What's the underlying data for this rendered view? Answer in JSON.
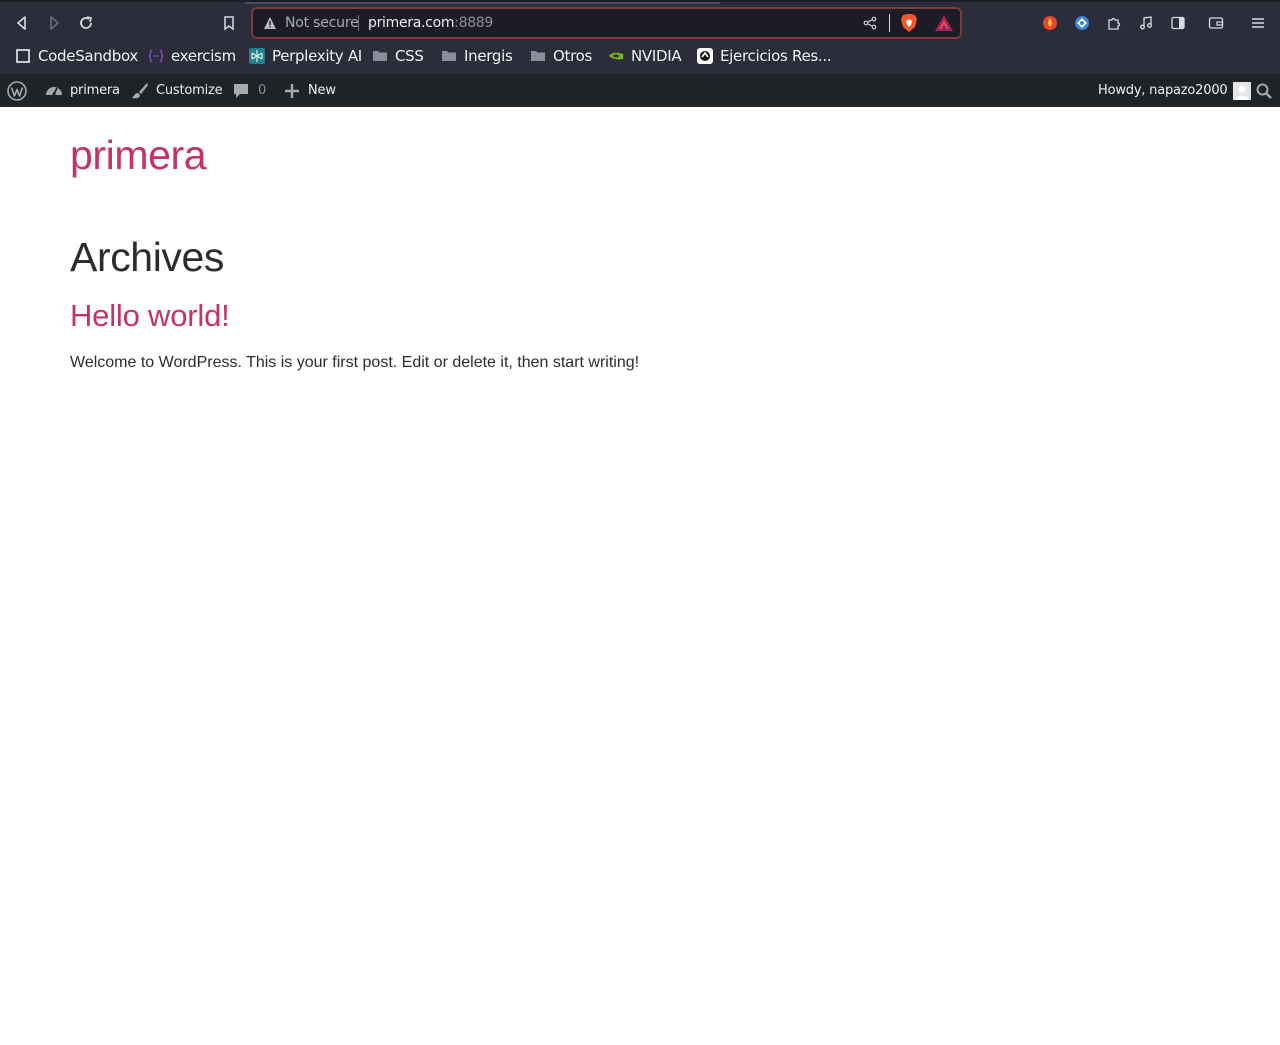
{
  "browser": {
    "url_security_label": "Not secure",
    "url_host": "primera.com",
    "url_port": ":8889",
    "bookmarks": [
      {
        "label": "CodeSandbox",
        "icon": "codesandbox-icon"
      },
      {
        "label": "exercism",
        "icon": "exercism-icon"
      },
      {
        "label": "Perplexity AI",
        "icon": "perplexity-icon"
      },
      {
        "label": "CSS",
        "icon": "folder-icon"
      },
      {
        "label": "Inergis",
        "icon": "folder-icon"
      },
      {
        "label": "Otros",
        "icon": "folder-icon"
      },
      {
        "label": "NVIDIA",
        "icon": "nvidia-icon"
      },
      {
        "label": "Ejercicios Res...",
        "icon": "site-icon"
      }
    ]
  },
  "adminbar": {
    "site_name": "primera",
    "customize_label": "Customize",
    "comments_count": "0",
    "new_label": "New",
    "greeting": "Howdy, napazo2000"
  },
  "page": {
    "site_title": "primera",
    "archive_heading": "Archives",
    "post": {
      "title": "Hello world!",
      "excerpt": "Welcome to WordPress. This is your first post. Edit or delete it, then start writing!"
    }
  },
  "colors": {
    "link_accent": "#c43463",
    "adminbar_bg": "#1d2327",
    "browser_bg": "#2b2d3a"
  }
}
